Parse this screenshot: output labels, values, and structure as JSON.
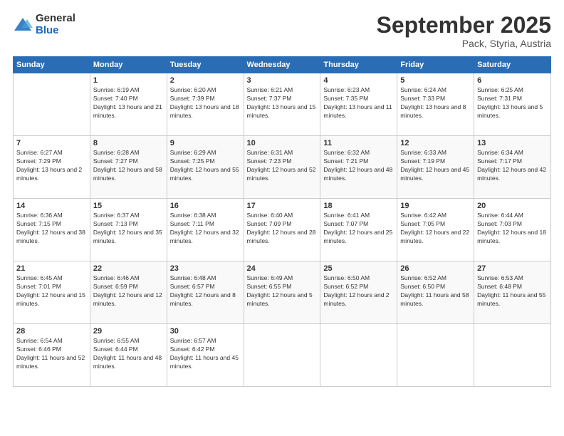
{
  "header": {
    "logo_general": "General",
    "logo_blue": "Blue",
    "month_title": "September 2025",
    "location": "Pack, Styria, Austria"
  },
  "weekdays": [
    "Sunday",
    "Monday",
    "Tuesday",
    "Wednesday",
    "Thursday",
    "Friday",
    "Saturday"
  ],
  "weeks": [
    [
      {
        "day": "",
        "sunrise": "",
        "sunset": "",
        "daylight": ""
      },
      {
        "day": "1",
        "sunrise": "Sunrise: 6:19 AM",
        "sunset": "Sunset: 7:40 PM",
        "daylight": "Daylight: 13 hours and 21 minutes."
      },
      {
        "day": "2",
        "sunrise": "Sunrise: 6:20 AM",
        "sunset": "Sunset: 7:39 PM",
        "daylight": "Daylight: 13 hours and 18 minutes."
      },
      {
        "day": "3",
        "sunrise": "Sunrise: 6:21 AM",
        "sunset": "Sunset: 7:37 PM",
        "daylight": "Daylight: 13 hours and 15 minutes."
      },
      {
        "day": "4",
        "sunrise": "Sunrise: 6:23 AM",
        "sunset": "Sunset: 7:35 PM",
        "daylight": "Daylight: 13 hours and 11 minutes."
      },
      {
        "day": "5",
        "sunrise": "Sunrise: 6:24 AM",
        "sunset": "Sunset: 7:33 PM",
        "daylight": "Daylight: 13 hours and 8 minutes."
      },
      {
        "day": "6",
        "sunrise": "Sunrise: 6:25 AM",
        "sunset": "Sunset: 7:31 PM",
        "daylight": "Daylight: 13 hours and 5 minutes."
      }
    ],
    [
      {
        "day": "7",
        "sunrise": "Sunrise: 6:27 AM",
        "sunset": "Sunset: 7:29 PM",
        "daylight": "Daylight: 13 hours and 2 minutes."
      },
      {
        "day": "8",
        "sunrise": "Sunrise: 6:28 AM",
        "sunset": "Sunset: 7:27 PM",
        "daylight": "Daylight: 12 hours and 58 minutes."
      },
      {
        "day": "9",
        "sunrise": "Sunrise: 6:29 AM",
        "sunset": "Sunset: 7:25 PM",
        "daylight": "Daylight: 12 hours and 55 minutes."
      },
      {
        "day": "10",
        "sunrise": "Sunrise: 6:31 AM",
        "sunset": "Sunset: 7:23 PM",
        "daylight": "Daylight: 12 hours and 52 minutes."
      },
      {
        "day": "11",
        "sunrise": "Sunrise: 6:32 AM",
        "sunset": "Sunset: 7:21 PM",
        "daylight": "Daylight: 12 hours and 48 minutes."
      },
      {
        "day": "12",
        "sunrise": "Sunrise: 6:33 AM",
        "sunset": "Sunset: 7:19 PM",
        "daylight": "Daylight: 12 hours and 45 minutes."
      },
      {
        "day": "13",
        "sunrise": "Sunrise: 6:34 AM",
        "sunset": "Sunset: 7:17 PM",
        "daylight": "Daylight: 12 hours and 42 minutes."
      }
    ],
    [
      {
        "day": "14",
        "sunrise": "Sunrise: 6:36 AM",
        "sunset": "Sunset: 7:15 PM",
        "daylight": "Daylight: 12 hours and 38 minutes."
      },
      {
        "day": "15",
        "sunrise": "Sunrise: 6:37 AM",
        "sunset": "Sunset: 7:13 PM",
        "daylight": "Daylight: 12 hours and 35 minutes."
      },
      {
        "day": "16",
        "sunrise": "Sunrise: 6:38 AM",
        "sunset": "Sunset: 7:11 PM",
        "daylight": "Daylight: 12 hours and 32 minutes."
      },
      {
        "day": "17",
        "sunrise": "Sunrise: 6:40 AM",
        "sunset": "Sunset: 7:09 PM",
        "daylight": "Daylight: 12 hours and 28 minutes."
      },
      {
        "day": "18",
        "sunrise": "Sunrise: 6:41 AM",
        "sunset": "Sunset: 7:07 PM",
        "daylight": "Daylight: 12 hours and 25 minutes."
      },
      {
        "day": "19",
        "sunrise": "Sunrise: 6:42 AM",
        "sunset": "Sunset: 7:05 PM",
        "daylight": "Daylight: 12 hours and 22 minutes."
      },
      {
        "day": "20",
        "sunrise": "Sunrise: 6:44 AM",
        "sunset": "Sunset: 7:03 PM",
        "daylight": "Daylight: 12 hours and 18 minutes."
      }
    ],
    [
      {
        "day": "21",
        "sunrise": "Sunrise: 6:45 AM",
        "sunset": "Sunset: 7:01 PM",
        "daylight": "Daylight: 12 hours and 15 minutes."
      },
      {
        "day": "22",
        "sunrise": "Sunrise: 6:46 AM",
        "sunset": "Sunset: 6:59 PM",
        "daylight": "Daylight: 12 hours and 12 minutes."
      },
      {
        "day": "23",
        "sunrise": "Sunrise: 6:48 AM",
        "sunset": "Sunset: 6:57 PM",
        "daylight": "Daylight: 12 hours and 8 minutes."
      },
      {
        "day": "24",
        "sunrise": "Sunrise: 6:49 AM",
        "sunset": "Sunset: 6:55 PM",
        "daylight": "Daylight: 12 hours and 5 minutes."
      },
      {
        "day": "25",
        "sunrise": "Sunrise: 6:50 AM",
        "sunset": "Sunset: 6:52 PM",
        "daylight": "Daylight: 12 hours and 2 minutes."
      },
      {
        "day": "26",
        "sunrise": "Sunrise: 6:52 AM",
        "sunset": "Sunset: 6:50 PM",
        "daylight": "Daylight: 11 hours and 58 minutes."
      },
      {
        "day": "27",
        "sunrise": "Sunrise: 6:53 AM",
        "sunset": "Sunset: 6:48 PM",
        "daylight": "Daylight: 11 hours and 55 minutes."
      }
    ],
    [
      {
        "day": "28",
        "sunrise": "Sunrise: 6:54 AM",
        "sunset": "Sunset: 6:46 PM",
        "daylight": "Daylight: 11 hours and 52 minutes."
      },
      {
        "day": "29",
        "sunrise": "Sunrise: 6:55 AM",
        "sunset": "Sunset: 6:44 PM",
        "daylight": "Daylight: 11 hours and 48 minutes."
      },
      {
        "day": "30",
        "sunrise": "Sunrise: 6:57 AM",
        "sunset": "Sunset: 6:42 PM",
        "daylight": "Daylight: 11 hours and 45 minutes."
      },
      {
        "day": "",
        "sunrise": "",
        "sunset": "",
        "daylight": ""
      },
      {
        "day": "",
        "sunrise": "",
        "sunset": "",
        "daylight": ""
      },
      {
        "day": "",
        "sunrise": "",
        "sunset": "",
        "daylight": ""
      },
      {
        "day": "",
        "sunrise": "",
        "sunset": "",
        "daylight": ""
      }
    ]
  ]
}
